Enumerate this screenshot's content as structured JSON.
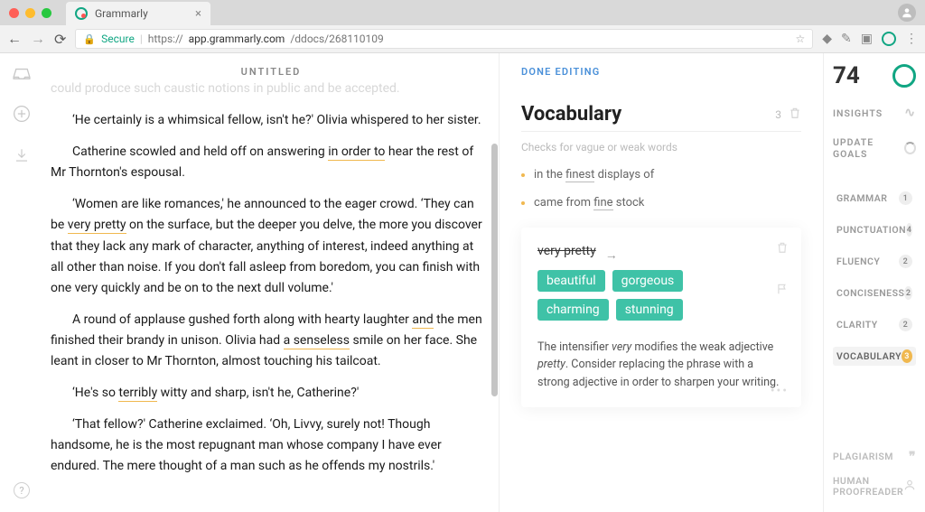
{
  "browser": {
    "tab_title": "Grammarly",
    "secure_label": "Secure",
    "url_prefix": "https://",
    "url_host": "app.grammarly.com",
    "url_path": "/ddocs/268110109"
  },
  "doc": {
    "title": "UNTITLED",
    "p_faded": "could produce such caustic notions in public and be accepted.",
    "p1a": "‘He certainly is a whimsical fellow, isn't he?' Olivia whispered to her sister.",
    "p2a": "Catherine scowled and held off on answering ",
    "p2_u": "in order to",
    "p2b": " hear the rest of Mr Thornton's espousal.",
    "p3a": "‘Women are like romances,' he announced to the eager crowd. ‘They can be ",
    "p3_u": "very pretty",
    "p3b": " on the surface, but the deeper you delve, the more you discover that they lack any mark of character, anything of interest, indeed anything at all other than noise. If you don't fall asleep from boredom, you can finish with one very quickly and be on to the next dull volume.'",
    "p4a": "A round of applause gushed forth along with hearty laughter ",
    "p4_u1": "and",
    "p4b": " the men finished their brandy in unison. Olivia had ",
    "p4_u2": "a senseless",
    "p4c": " smile on her face. She leant in closer to Mr Thornton, almost touching his tailcoat.",
    "p5a": "‘He's so ",
    "p5_u": "terribly",
    "p5b": " witty and sharp, isn't he, Catherine?'",
    "p6": "‘That fellow?' Catherine exclaimed. ‘Oh, Livvy, surely not! Though handsome, he is the most repugnant man whose company I have ever endured. The mere thought of a man such as he offends my nostrils.'"
  },
  "panel": {
    "done": "DONE EDITING",
    "heading": "Vocabulary",
    "count": "3",
    "subtitle": "Checks for vague or weak words",
    "issue1_pre": "in the ",
    "issue1_u": "finest",
    "issue1_post": " displays of",
    "issue2_pre": "came from ",
    "issue2_u": "fine",
    "issue2_post": " stock",
    "card": {
      "phrase": "very pretty",
      "suggestions": [
        "beautiful",
        "gorgeous",
        "charming",
        "stunning"
      ],
      "expl_1": "The intensifier ",
      "expl_em1": "very",
      "expl_2": " modifies the weak adjective ",
      "expl_em2": "pretty",
      "expl_3": ". Consider replacing the phrase with a strong adjective in order to sharpen your writing."
    }
  },
  "rail": {
    "score": "74",
    "insights": "INSIGHTS",
    "goals": "UPDATE GOALS",
    "categories": [
      {
        "label": "GRAMMAR",
        "count": "1"
      },
      {
        "label": "PUNCTUATION",
        "count": "4"
      },
      {
        "label": "FLUENCY",
        "count": "2"
      },
      {
        "label": "CONCISENESS",
        "count": "2"
      },
      {
        "label": "CLARITY",
        "count": "2"
      },
      {
        "label": "VOCABULARY",
        "count": "3"
      }
    ],
    "plagiarism": "PLAGIARISM",
    "human": "HUMAN PROOFREADER"
  }
}
